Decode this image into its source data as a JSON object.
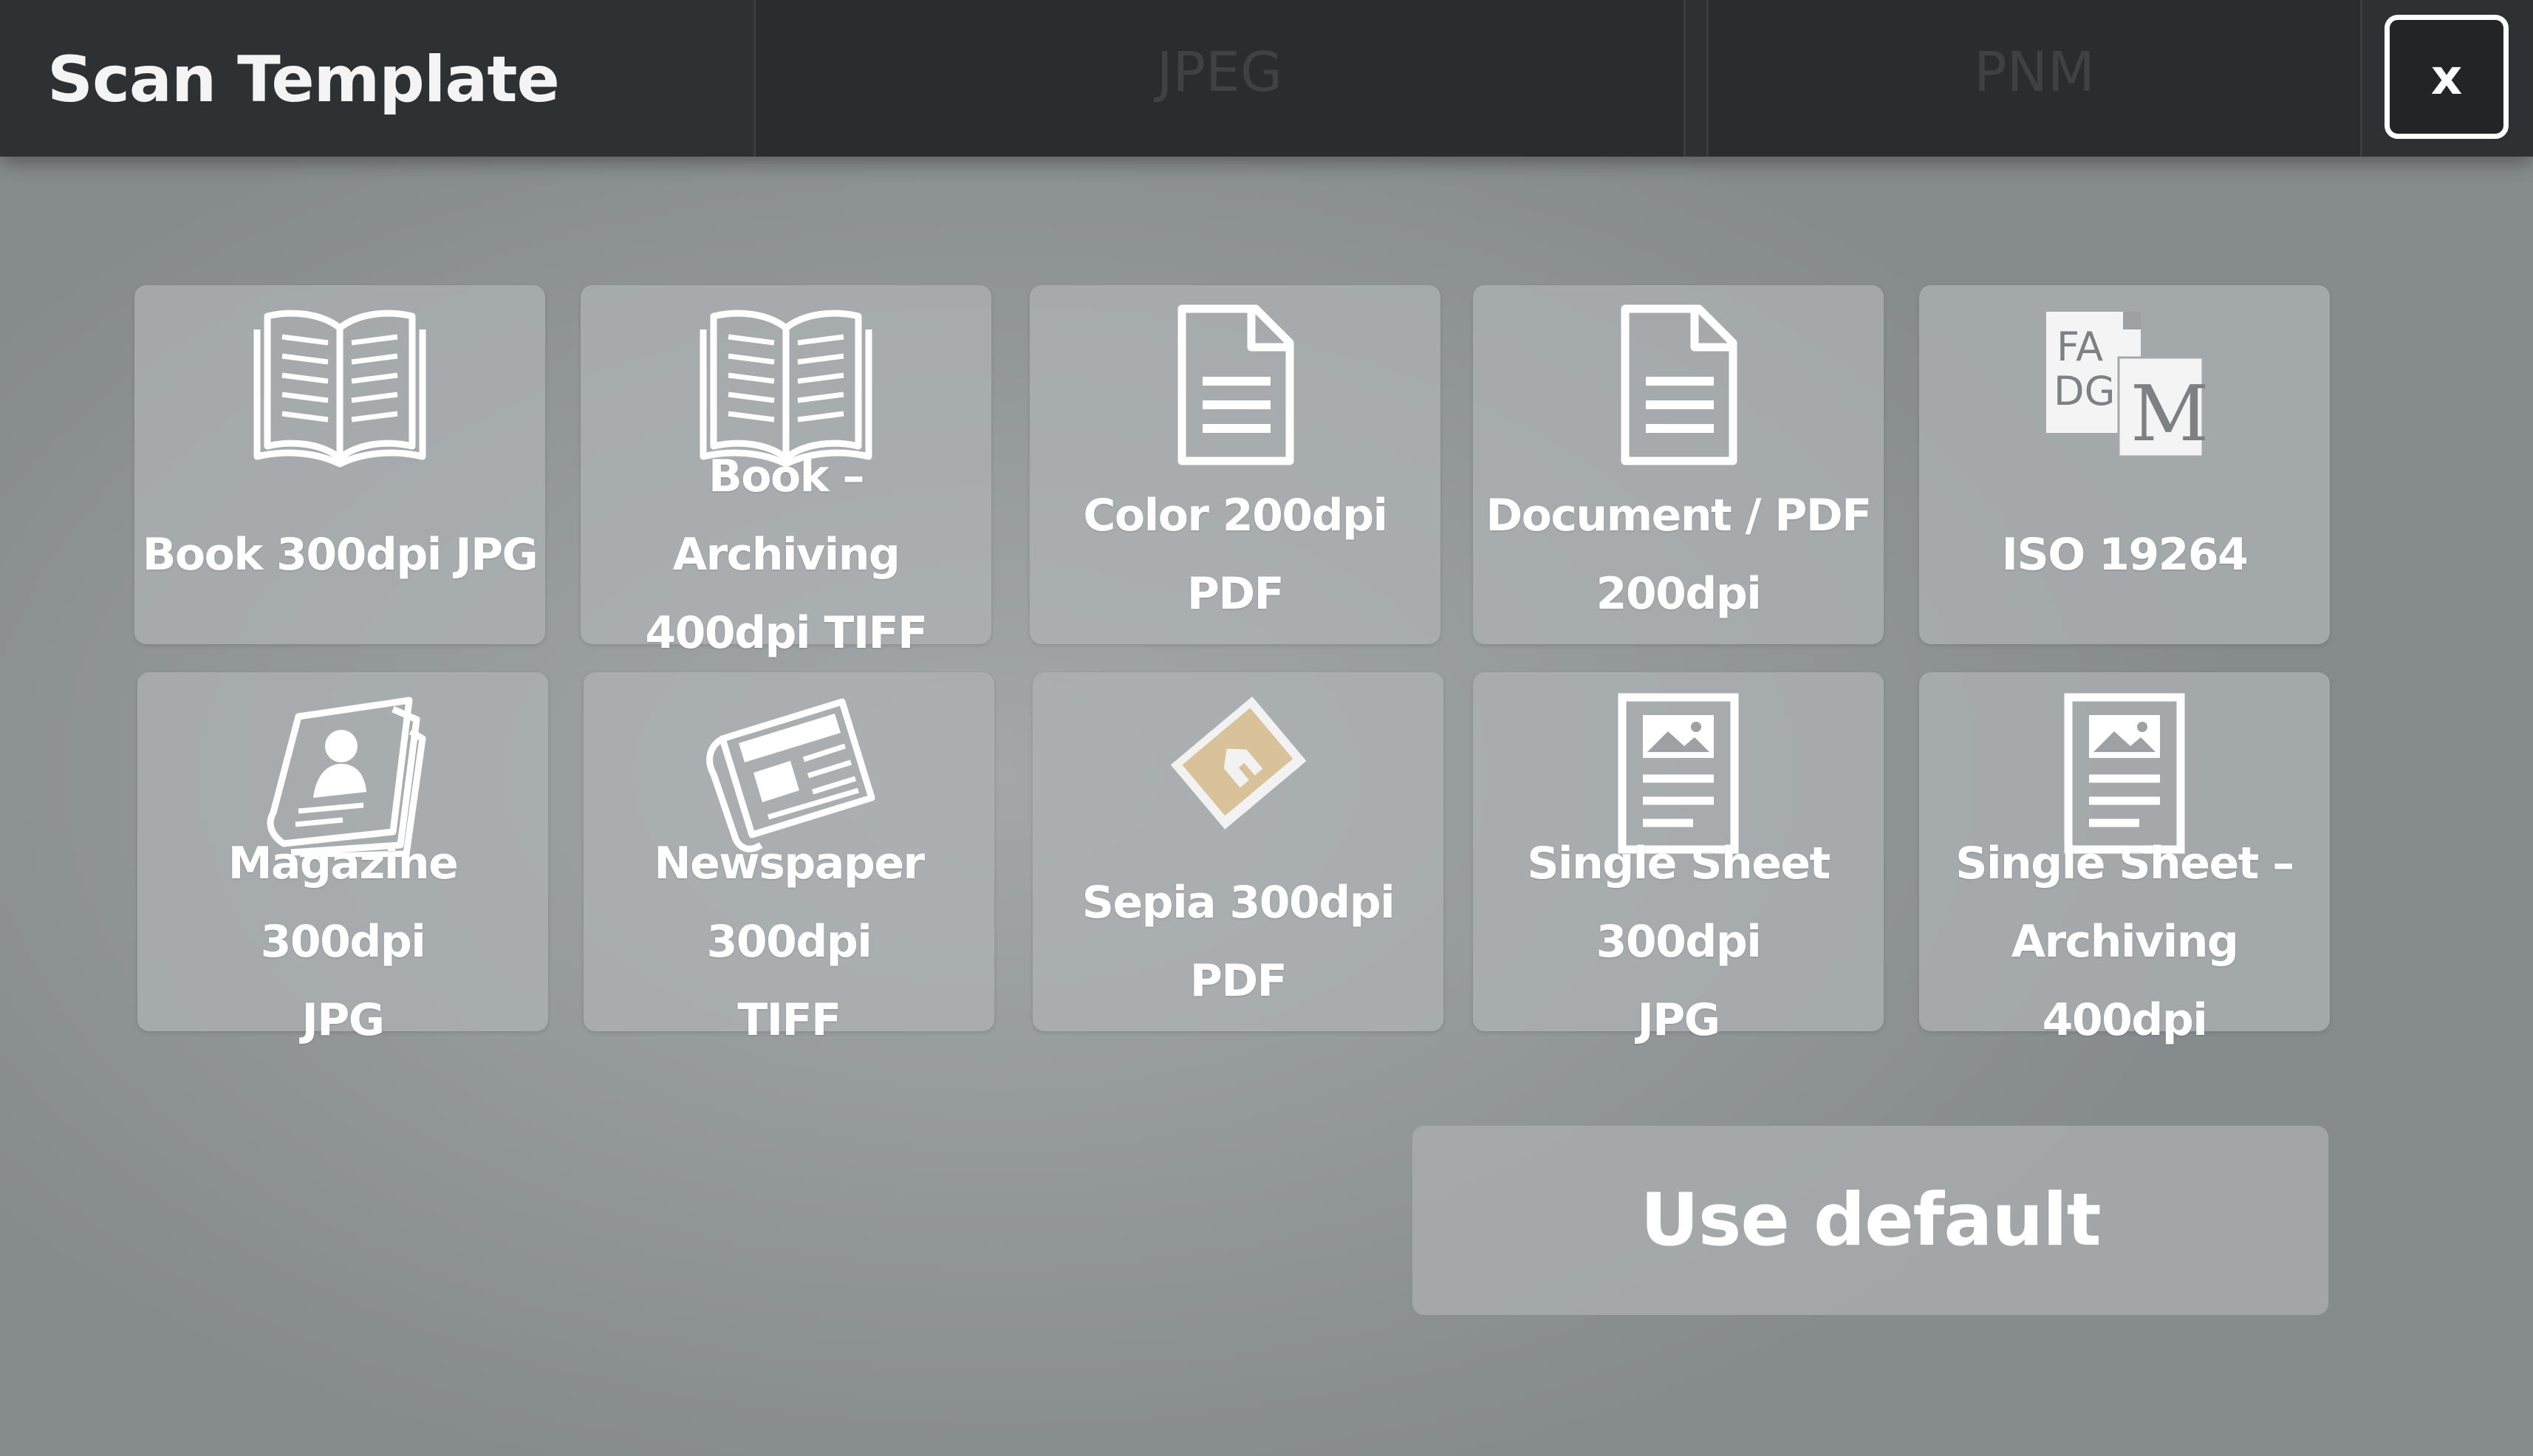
{
  "dialog": {
    "title": "Scan Template",
    "close_label": "x"
  },
  "background_tabs": [
    "JPEG",
    "PNM"
  ],
  "templates": [
    {
      "label": "Book 300dpi JPG",
      "icon": "open-book-icon"
    },
    {
      "label": "Book – Archiving\n400dpi TIFF",
      "icon": "open-book-icon"
    },
    {
      "label": "Color 200dpi PDF",
      "icon": "document-icon"
    },
    {
      "label": "Document / PDF\n200dpi",
      "icon": "document-icon"
    },
    {
      "label": "ISO 19264",
      "icon": "fadgi-iso-icon",
      "icon_text": [
        "FA",
        "DGI",
        "M"
      ]
    },
    {
      "label": "Magazine 300dpi\nJPG",
      "icon": "magazine-icon"
    },
    {
      "label": "Newspaper 300dpi\nTIFF",
      "icon": "newspaper-icon"
    },
    {
      "label": "Sepia 300dpi PDF",
      "icon": "sepia-photo-icon"
    },
    {
      "label": "Single Sheet 300dpi\nJPG",
      "icon": "single-sheet-icon"
    },
    {
      "label": "Single Sheet –\nArchiving 400dpi",
      "icon": "single-sheet-icon"
    }
  ],
  "default_button": {
    "label": "Use default"
  },
  "colors": {
    "titlebar": "#2e3134",
    "tile": "#afb3b5",
    "text": "#ffffff",
    "sepia_accent": "#d9c29a"
  }
}
